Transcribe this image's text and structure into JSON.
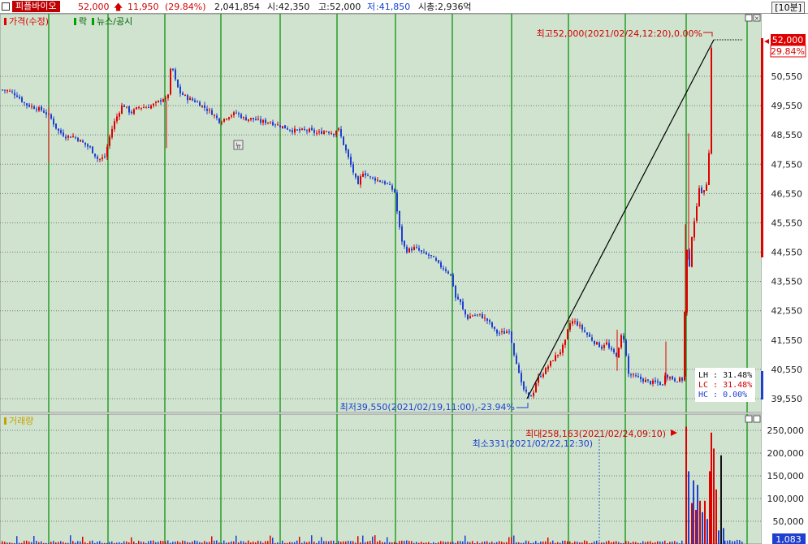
{
  "header": {
    "name": "피플바이오",
    "price": "52,000",
    "change": "11,950",
    "change_pct": "(29.84%)",
    "volume": "2,041,854",
    "open": "시:42,350",
    "high": "고:52,000",
    "low_prefix": "저",
    "low_value": ":41,850",
    "market_cap": "시총:2,936억",
    "period": "[10분]"
  },
  "price_panel": {
    "legend_price": "가격(수정)",
    "legend_rak": "락",
    "legend_news": "뉴스/공시",
    "news_marker": "뉴",
    "high_annotation": "최고52,000(2021/02/24,12:20),0.00%",
    "low_annotation": "최저39,550(2021/02/19,11:00),-23.94%",
    "current_price_box": "52,000",
    "current_pct_box": "29.84%",
    "lh_line": "LH : 31.48%",
    "lc_line": "LC : 31.48%",
    "hc_line": "HC :  0.00%"
  },
  "volume_panel": {
    "legend": "거래량",
    "max_annotation": "최대258,163(2021/02/24,09:10)",
    "min_annotation": "최소331(2021/02/22,12:30)",
    "current_volume_box": "1,083"
  },
  "colors": {
    "background": "#cfe3cf",
    "up": "#e00000",
    "down": "#1f3fd0",
    "separator": "#008a00"
  },
  "chart_data": [
    {
      "type": "candlestick",
      "title": "가격(수정)",
      "y_ticks": [
        39550,
        40550,
        41550,
        42550,
        43550,
        44550,
        45550,
        46550,
        47550,
        48550,
        49550,
        50550
      ],
      "ylim": [
        39000,
        52700
      ],
      "close_path": [
        [
          0,
          50100
        ],
        [
          10,
          50050
        ],
        [
          20,
          49900
        ],
        [
          30,
          49600
        ],
        [
          40,
          49500
        ],
        [
          50,
          49400
        ],
        [
          60,
          49200
        ],
        [
          70,
          48700
        ],
        [
          80,
          48500
        ],
        [
          90,
          48500
        ],
        [
          100,
          48300
        ],
        [
          110,
          48100
        ],
        [
          120,
          47700
        ],
        [
          128,
          47800
        ],
        [
          135,
          48600
        ],
        [
          140,
          49000
        ],
        [
          150,
          49600
        ],
        [
          160,
          49300
        ],
        [
          170,
          49500
        ],
        [
          180,
          49500
        ],
        [
          190,
          49600
        ],
        [
          200,
          49800
        ],
        [
          205,
          49700
        ],
        [
          210,
          51000
        ],
        [
          215,
          50400
        ],
        [
          220,
          50000
        ],
        [
          230,
          49800
        ],
        [
          240,
          49700
        ],
        [
          250,
          49500
        ],
        [
          260,
          49300
        ],
        [
          270,
          49000
        ],
        [
          280,
          49200
        ],
        [
          290,
          49300
        ],
        [
          300,
          49100
        ],
        [
          310,
          49100
        ],
        [
          320,
          49000
        ],
        [
          330,
          49000
        ],
        [
          340,
          48900
        ],
        [
          350,
          48800
        ],
        [
          360,
          48700
        ],
        [
          370,
          48700
        ],
        [
          380,
          48700
        ],
        [
          390,
          48600
        ],
        [
          400,
          48700
        ],
        [
          410,
          48600
        ],
        [
          415,
          48800
        ],
        [
          420,
          48400
        ],
        [
          430,
          47600
        ],
        [
          440,
          46800
        ],
        [
          445,
          47300
        ],
        [
          455,
          47100
        ],
        [
          465,
          47000
        ],
        [
          475,
          46900
        ],
        [
          485,
          46600
        ],
        [
          490,
          45500
        ],
        [
          495,
          44800
        ],
        [
          500,
          44600
        ],
        [
          510,
          44700
        ],
        [
          520,
          44500
        ],
        [
          530,
          44400
        ],
        [
          540,
          44100
        ],
        [
          550,
          43900
        ],
        [
          555,
          43700
        ],
        [
          560,
          43000
        ],
        [
          565,
          42900
        ],
        [
          570,
          42500
        ],
        [
          575,
          42300
        ],
        [
          580,
          42400
        ],
        [
          590,
          42400
        ],
        [
          600,
          42200
        ],
        [
          610,
          41800
        ],
        [
          620,
          41800
        ],
        [
          627,
          41900
        ],
        [
          630,
          41300
        ],
        [
          635,
          40800
        ],
        [
          640,
          40100
        ],
        [
          645,
          39800
        ],
        [
          650,
          39600
        ],
        [
          655,
          39700
        ],
        [
          660,
          40200
        ],
        [
          670,
          40500
        ],
        [
          680,
          40900
        ],
        [
          690,
          41200
        ],
        [
          695,
          41500
        ],
        [
          700,
          42100
        ],
        [
          705,
          42200
        ],
        [
          710,
          42100
        ],
        [
          720,
          41800
        ],
        [
          730,
          41500
        ],
        [
          740,
          41300
        ],
        [
          745,
          41500
        ],
        [
          750,
          41200
        ],
        [
          755,
          41100
        ],
        [
          760,
          41000
        ],
        [
          763,
          41700
        ],
        [
          768,
          41600
        ],
        [
          772,
          40400
        ],
        [
          780,
          40300
        ],
        [
          790,
          40200
        ],
        [
          800,
          40100
        ],
        [
          810,
          40100
        ],
        [
          815,
          40000
        ],
        [
          818,
          40400
        ],
        [
          822,
          40300
        ],
        [
          830,
          40200
        ],
        [
          840,
          40200
        ],
        [
          844,
          44800
        ],
        [
          848,
          44000
        ],
        [
          852,
          45500
        ],
        [
          856,
          45800
        ],
        [
          860,
          46800
        ],
        [
          865,
          46500
        ],
        [
          870,
          47000
        ],
        [
          872,
          48000
        ],
        [
          875,
          51500
        ],
        [
          877,
          52000
        ]
      ],
      "annotations": [
        {
          "text": "최고52,000(2021/02/24,12:20),0.00%",
          "price": 52000
        },
        {
          "text": "최저39,550(2021/02/19,11:00),-23.94%",
          "price": 39550
        }
      ]
    },
    {
      "type": "bar",
      "title": "거래량",
      "y_ticks": [
        50000,
        100000,
        150000,
        200000,
        250000
      ],
      "ylim": [
        0,
        280000
      ],
      "spikes": [
        {
          "x": 844,
          "value": 258163,
          "color": "#e00000"
        },
        {
          "x": 847,
          "value": 160000,
          "color": "#1f3fd0"
        },
        {
          "x": 851,
          "value": 90000,
          "color": "#e00000"
        },
        {
          "x": 853,
          "value": 140000,
          "color": "#1f3fd0"
        },
        {
          "x": 856,
          "value": 75000,
          "color": "#e00000"
        },
        {
          "x": 858,
          "value": 130000,
          "color": "#1f3fd0"
        },
        {
          "x": 861,
          "value": 95000,
          "color": "#e00000"
        },
        {
          "x": 864,
          "value": 70000,
          "color": "#1f3fd0"
        },
        {
          "x": 867,
          "value": 95000,
          "color": "#e00000"
        },
        {
          "x": 870,
          "value": 55000,
          "color": "#1f3fd0"
        },
        {
          "x": 873,
          "value": 160000,
          "color": "#e00000"
        },
        {
          "x": 875,
          "value": 245000,
          "color": "#e00000"
        },
        {
          "x": 878,
          "value": 210000,
          "color": "#e00000"
        },
        {
          "x": 881,
          "value": 120000,
          "color": "#e00000"
        },
        {
          "x": 884,
          "value": 30000,
          "color": "#1f3fd0"
        },
        {
          "x": 887,
          "value": 195000,
          "color": "#111111"
        },
        {
          "x": 890,
          "value": 35000,
          "color": "#1f3fd0"
        }
      ]
    }
  ]
}
